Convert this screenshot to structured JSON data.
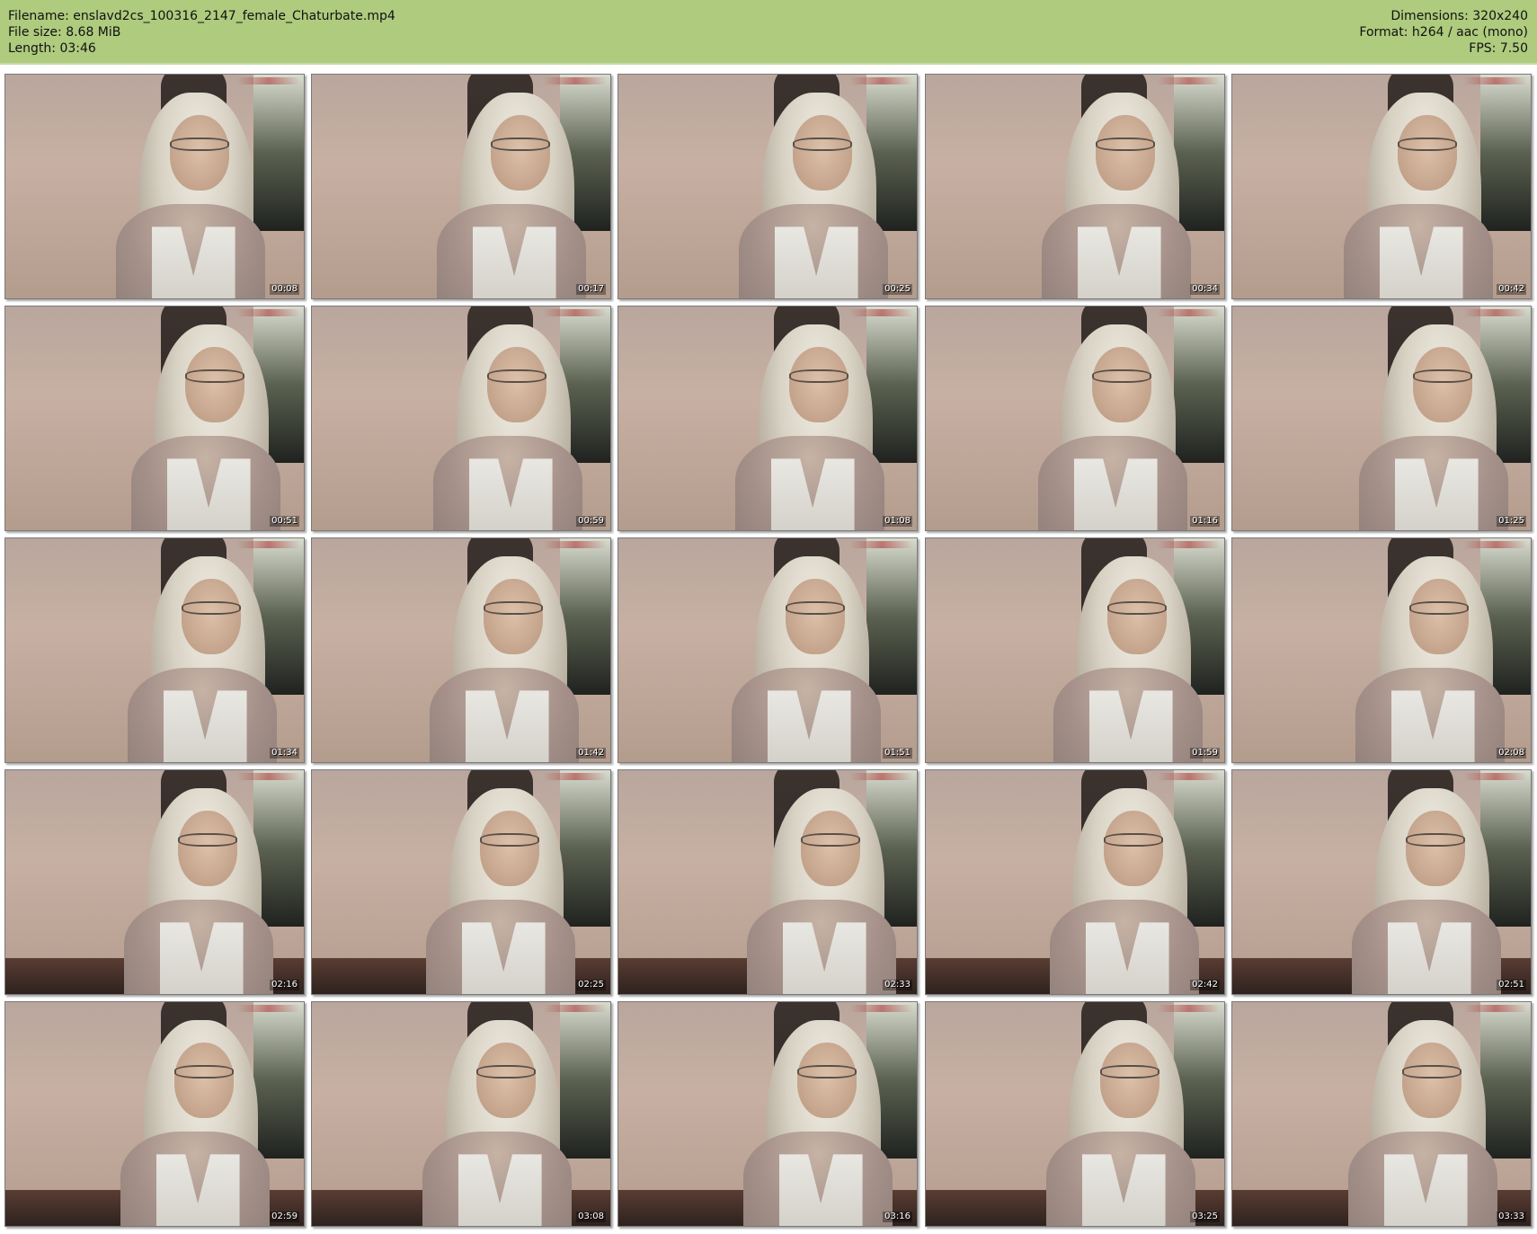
{
  "header": {
    "filename_label": "Filename: enslavd2cs_100316_2147_female_Chaturbate.mp4",
    "filesize_label": "File size: 8.68 MiB",
    "length_label": "Length: 03:46",
    "dimensions_label": "Dimensions: 320x240",
    "format_label": "Format: h264 / aac (mono)",
    "fps_label": "FPS: 7.50",
    "background_color": "#aecb7e"
  },
  "thumbnails": [
    {
      "time": "00:08"
    },
    {
      "time": "00:17"
    },
    {
      "time": "00:25"
    },
    {
      "time": "00:34"
    },
    {
      "time": "00:42"
    },
    {
      "time": "00:51"
    },
    {
      "time": "00:59"
    },
    {
      "time": "01:08"
    },
    {
      "time": "01:16"
    },
    {
      "time": "01:25"
    },
    {
      "time": "01:34"
    },
    {
      "time": "01:42"
    },
    {
      "time": "01:51"
    },
    {
      "time": "01:59"
    },
    {
      "time": "02:08"
    },
    {
      "time": "02:16"
    },
    {
      "time": "02:25"
    },
    {
      "time": "02:33"
    },
    {
      "time": "02:42"
    },
    {
      "time": "02:51"
    },
    {
      "time": "02:59"
    },
    {
      "time": "03:08"
    },
    {
      "time": "03:16"
    },
    {
      "time": "03:25"
    },
    {
      "time": "03:33"
    }
  ]
}
